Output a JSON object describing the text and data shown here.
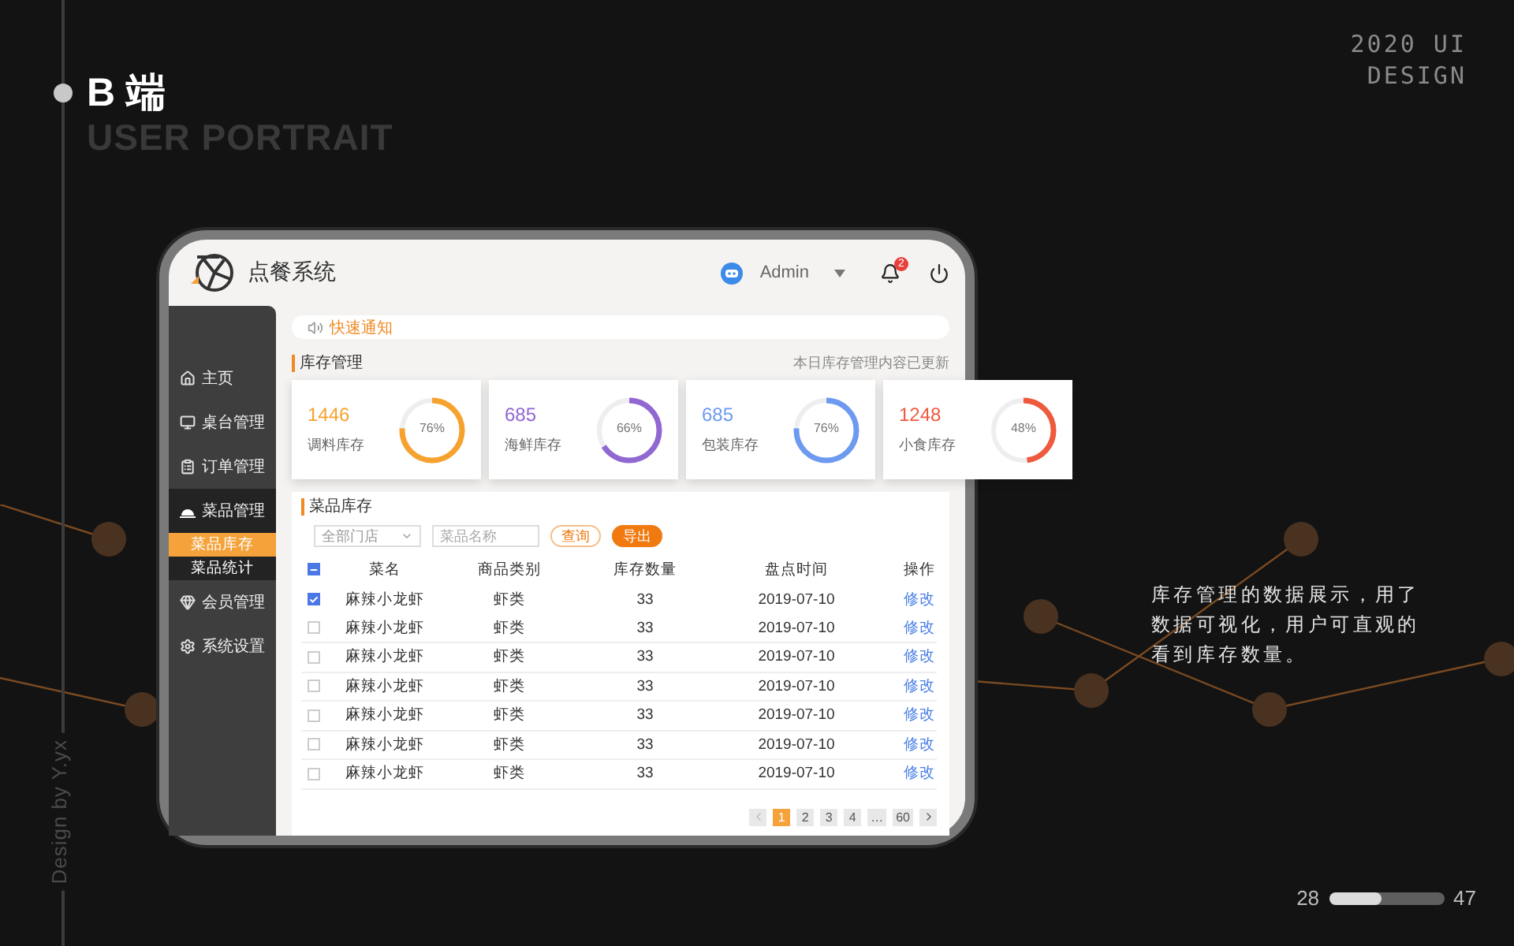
{
  "slide": {
    "title": "B 端",
    "subtitle": "USER PORTRAIT",
    "corner_lines": [
      "2020 UI",
      "DESIGN"
    ],
    "credit": "Design by Y.yx",
    "description": "库存管理的数据展示，用了数据可视化，用户可直观的看到库存数量。",
    "pager": {
      "current": "28",
      "total": "47",
      "level": 0.46
    }
  },
  "app": {
    "title": "点餐系统",
    "user": "Admin",
    "notification_count": "2",
    "sidebar": [
      {
        "label": "主页",
        "selected": false
      },
      {
        "label": "桌台管理",
        "selected": false
      },
      {
        "label": "订单管理",
        "selected": false
      },
      {
        "label": "菜品管理",
        "selected": false,
        "expanded": true,
        "children": [
          {
            "label": "菜品库存",
            "selected": true
          },
          {
            "label": "菜品统计",
            "selected": false
          }
        ]
      },
      {
        "label": "会员管理",
        "selected": false
      },
      {
        "label": "系统设置",
        "selected": false
      }
    ],
    "notice": "快速通知",
    "section": {
      "title": "库存管理",
      "note": "本日库存管理内容已更新"
    },
    "cards": [
      {
        "value": "1446",
        "label": "调料库存",
        "percent": "76%",
        "level": 0.76,
        "color": "#f5a22e"
      },
      {
        "value": "685",
        "label": "海鲜库存",
        "percent": "66%",
        "level": 0.66,
        "color": "#9167d2"
      },
      {
        "value": "685",
        "label": "包装库存",
        "percent": "76%",
        "level": 0.76,
        "color": "#6d9af0"
      },
      {
        "value": "1248",
        "label": "小食库存",
        "percent": "48%",
        "level": 0.48,
        "color": "#ee5a3e"
      }
    ],
    "inventory": {
      "title": "菜品库存",
      "store_select": "全部门店",
      "name_placeholder": "菜品名称",
      "buttons": [
        {
          "label": "查询",
          "kind": "outline"
        },
        {
          "label": "导出",
          "kind": "filled"
        }
      ],
      "select_all_indeterminate": true,
      "columns": [
        "菜名",
        "商品类别",
        "库存数量",
        "盘点时间",
        "操作"
      ],
      "rows": [
        {
          "checked": true,
          "cells": [
            "麻辣小龙虾",
            "虾类",
            "33",
            "2019-07-10"
          ],
          "action": "修改"
        },
        {
          "checked": false,
          "cells": [
            "麻辣小龙虾",
            "虾类",
            "33",
            "2019-07-10"
          ],
          "action": "修改"
        },
        {
          "checked": false,
          "cells": [
            "麻辣小龙虾",
            "虾类",
            "33",
            "2019-07-10"
          ],
          "action": "修改"
        },
        {
          "checked": false,
          "cells": [
            "麻辣小龙虾",
            "虾类",
            "33",
            "2019-07-10"
          ],
          "action": "修改"
        },
        {
          "checked": false,
          "cells": [
            "麻辣小龙虾",
            "虾类",
            "33",
            "2019-07-10"
          ],
          "action": "修改"
        },
        {
          "checked": false,
          "cells": [
            "麻辣小龙虾",
            "虾类",
            "33",
            "2019-07-10"
          ],
          "action": "修改"
        },
        {
          "checked": false,
          "cells": [
            "麻辣小龙虾",
            "虾类",
            "33",
            "2019-07-10"
          ],
          "action": "修改"
        }
      ],
      "pagination": {
        "prev_disabled": true,
        "next_disabled": false,
        "pages": [
          {
            "label": "1",
            "selected": true
          },
          {
            "label": "2",
            "selected": false
          },
          {
            "label": "3",
            "selected": false
          },
          {
            "label": "4",
            "selected": false
          },
          {
            "label": "…",
            "selected": false
          },
          {
            "label": "60",
            "selected": false
          }
        ]
      }
    }
  }
}
